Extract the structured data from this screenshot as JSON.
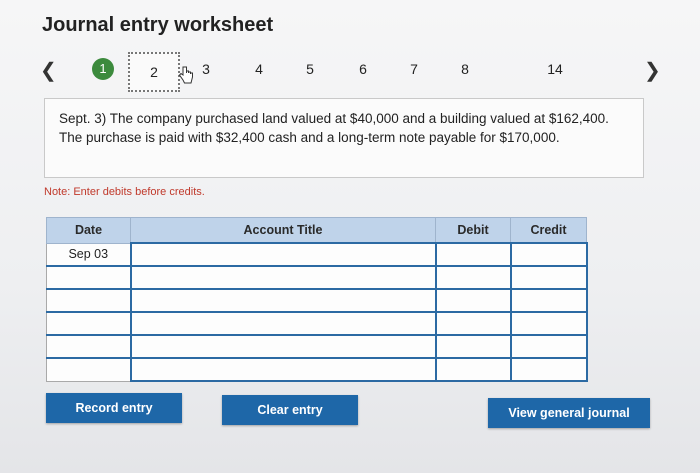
{
  "header": {
    "title": "Journal entry worksheet"
  },
  "nav": {
    "prev_icon": "chevron-left-icon",
    "next_icon": "chevron-right-icon",
    "steps": [
      "1",
      "2",
      "3",
      "4",
      "5",
      "6",
      "7",
      "8",
      "14"
    ],
    "completed_color": "#3c8a3d"
  },
  "question": {
    "text": "Sept. 3) The company purchased land valued at $40,000 and a building valued at $162,400. The purchase is paid with $32,400 cash and a long-term note payable for $170,000."
  },
  "note": "Note: Enter debits before credits.",
  "table": {
    "headers": [
      "Date",
      "Account Title",
      "Debit",
      "Credit"
    ],
    "rows": [
      [
        "Sep 03",
        "",
        "",
        ""
      ],
      [
        "",
        "",
        "",
        ""
      ],
      [
        "",
        "",
        "",
        ""
      ],
      [
        "",
        "",
        "",
        ""
      ],
      [
        "",
        "",
        "",
        ""
      ],
      [
        "",
        "",
        "",
        ""
      ]
    ],
    "header_color": "#bfd3ea",
    "input_border_color": "#2c6aa3"
  },
  "buttons": {
    "record": "Record entry",
    "clear": "Clear entry",
    "view": "View general journal",
    "color": "#1e67a8"
  }
}
